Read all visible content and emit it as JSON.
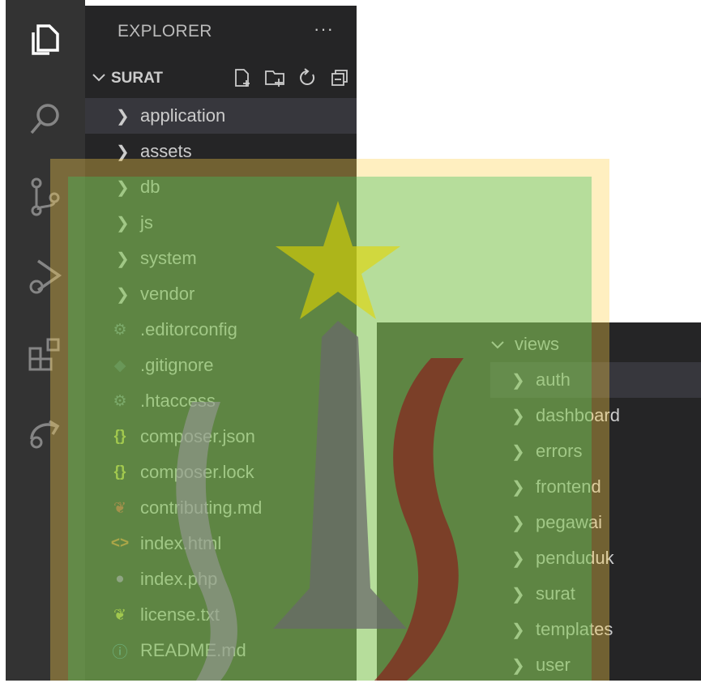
{
  "explorer": {
    "title": "EXPLORER",
    "more": "···",
    "section": "SURAT"
  },
  "activity_icons": [
    "explorer-icon",
    "search-icon",
    "source-control-icon",
    "run-debug-icon",
    "extensions-icon",
    "remote-icon"
  ],
  "tree": [
    {
      "label": "application",
      "type": "folder",
      "selected": true
    },
    {
      "label": "assets",
      "type": "folder"
    },
    {
      "label": "db",
      "type": "folder"
    },
    {
      "label": "js",
      "type": "folder"
    },
    {
      "label": "system",
      "type": "folder"
    },
    {
      "label": "vendor",
      "type": "folder"
    },
    {
      "label": ".editorconfig",
      "type": "file",
      "icon": "gear-icon",
      "color": "#6d8086"
    },
    {
      "label": ".gitignore",
      "type": "file",
      "icon": "git-icon",
      "color": "#41535b"
    },
    {
      "label": ".htaccess",
      "type": "file",
      "icon": "gear-icon",
      "color": "#6d8086"
    },
    {
      "label": "composer.json",
      "type": "file",
      "icon": "json-icon",
      "color": "#cbcb41"
    },
    {
      "label": "composer.lock",
      "type": "file",
      "icon": "json-icon",
      "color": "#cbcb41"
    },
    {
      "label": "contributing.md",
      "type": "file",
      "icon": "ribbon-icon",
      "color": "#d4443d"
    },
    {
      "label": "index.html",
      "type": "file",
      "icon": "html-icon",
      "color": "#e37933"
    },
    {
      "label": "index.php",
      "type": "file",
      "icon": "php-icon",
      "color": "#a074c4"
    },
    {
      "label": "license.txt",
      "type": "file",
      "icon": "license-icon",
      "color": "#cbcb41"
    },
    {
      "label": "README.md",
      "type": "file",
      "icon": "info-icon",
      "color": "#519aba"
    }
  ],
  "views_panel": {
    "folder": "views",
    "items": [
      "auth",
      "dashboard",
      "errors",
      "frontend",
      "pegawai",
      "penduduk",
      "surat",
      "templates",
      "user"
    ]
  }
}
